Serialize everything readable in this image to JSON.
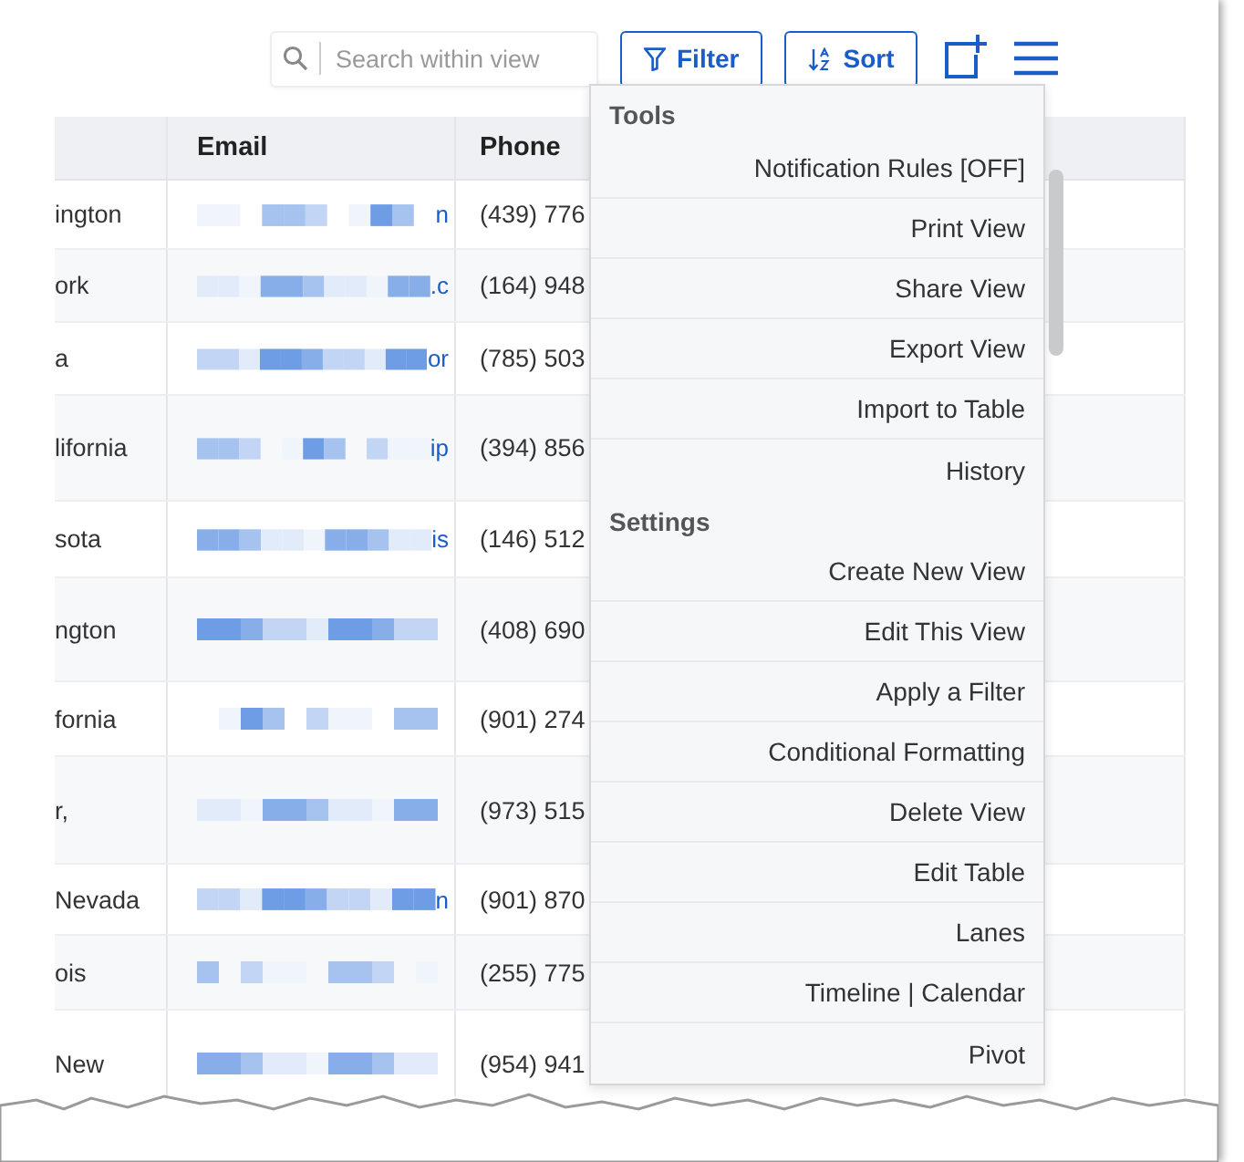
{
  "toolbar": {
    "search": {
      "placeholder": "Search within view"
    },
    "buttons": [
      {
        "label": "Filter",
        "kind": "filter"
      },
      {
        "label": "Sort",
        "kind": "sort"
      }
    ]
  },
  "table": {
    "columns": [
      "Email",
      "Phone"
    ],
    "rows": [
      {
        "column_1": "ington",
        "email": "n",
        "phone": "(439) 776"
      },
      {
        "column_1": "ork",
        "email": ".c",
        "phone": "(164) 948"
      },
      {
        "column_1": "a",
        "email": "or",
        "phone": "(785) 503"
      },
      {
        "column_1": "lifornia",
        "email": "ip",
        "phone": "(394) 856"
      },
      {
        "column_1": "sota",
        "email": "is",
        "phone": "(146) 512"
      },
      {
        "column_1": "ngton",
        "phone": "(408) 690"
      },
      {
        "column_1": "fornia",
        "phone": "(901) 274"
      },
      {
        "column_1": "r,",
        "phone": "(973) 515"
      },
      {
        "column_1": "Nevada",
        "email": "n",
        "phone": "(901) 870"
      },
      {
        "column_1": "ois",
        "phone": "(255) 775"
      },
      {
        "column_1": "New",
        "phone": "(954) 941"
      }
    ]
  },
  "menu": {
    "sections": [
      {
        "title": "Tools",
        "items": [
          "Notification Rules [OFF]",
          "Print View",
          "Share View",
          "Export View",
          "Import to Table",
          "History"
        ]
      },
      {
        "title": "Settings",
        "items": [
          "Create New View",
          "Edit This View",
          "Apply a Filter",
          "Conditional Formatting",
          "Delete View",
          "Edit Table",
          "Lanes",
          "Timeline | Calendar",
          "Pivot"
        ]
      }
    ]
  }
}
